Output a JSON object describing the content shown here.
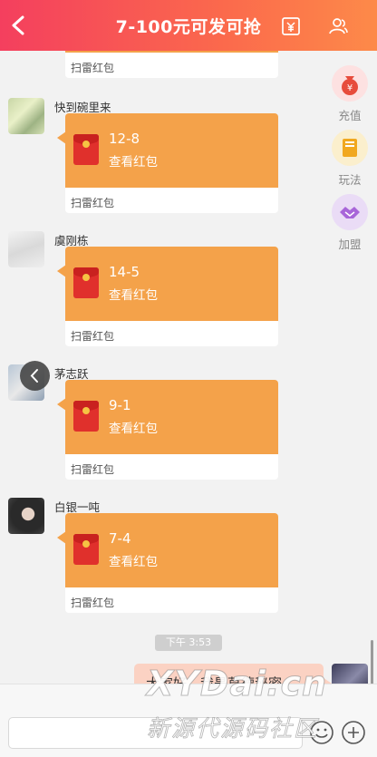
{
  "header": {
    "title": "7-100元可发可抢",
    "back_icon": "chevron-left-icon",
    "wallet_icon": "yen-wallet-icon",
    "members_icon": "people-icon"
  },
  "colors": {
    "header_start": "#f43f5e",
    "header_end": "#fd8a49",
    "packet": "#f4a24a",
    "envelope": "#e0302c",
    "my_bubble": "#fbd2c3"
  },
  "top_partial_packet": {
    "footer": "扫雷红包"
  },
  "messages": [
    {
      "sender": "快到碗里来",
      "amount": "12-8",
      "action": "查看红包",
      "footer": "扫雷红包"
    },
    {
      "sender": "虞刚栋",
      "amount": "14-5",
      "action": "查看红包",
      "footer": "扫雷红包"
    },
    {
      "sender": "茅志跃",
      "amount": "9-1",
      "action": "查看红包",
      "footer": "扫雷红包"
    },
    {
      "sender": "白银一吨",
      "amount": "7-4",
      "action": "查看红包",
      "footer": "扫雷红包"
    }
  ],
  "side_actions": [
    {
      "label": "充值",
      "icon": "money-bag-icon"
    },
    {
      "label": "玩法",
      "icon": "book-icon"
    },
    {
      "label": "加盟",
      "icon": "handshake-icon"
    }
  ],
  "timestamp": "下午 3:53",
  "my_message": {
    "text": "大家好，我是草德秘密"
  },
  "input": {
    "value": "",
    "placeholder": ""
  },
  "watermark": {
    "line1": "XYDai.cn",
    "line2": "新源代源码社区"
  }
}
